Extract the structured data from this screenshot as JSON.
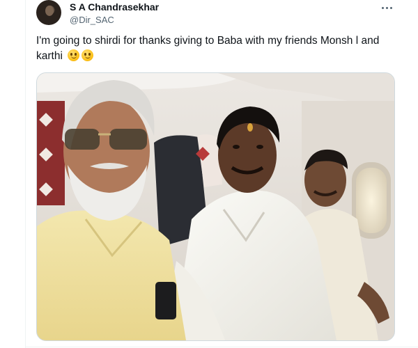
{
  "tweet": {
    "author": {
      "display_name": "S A Chandrasekhar",
      "handle": "@Dir_SAC",
      "avatar_icon": "profile-photo"
    },
    "more_icon": "more-options-icon",
    "text": "I'm going to shirdi for thanks giving to Baba with my friends Monsh l and karthi",
    "emojis": [
      "slightly-smiling-face",
      "slightly-smiling-face"
    ],
    "media": {
      "type": "photo",
      "subject": "selfie-in-airplane-cabin"
    }
  },
  "colors": {
    "text_primary": "#0f1419",
    "text_secondary": "#536471",
    "border": "#cfd9de",
    "shirt_yellow": "#f2e3a2",
    "shirt_white": "#f5f4ee"
  }
}
